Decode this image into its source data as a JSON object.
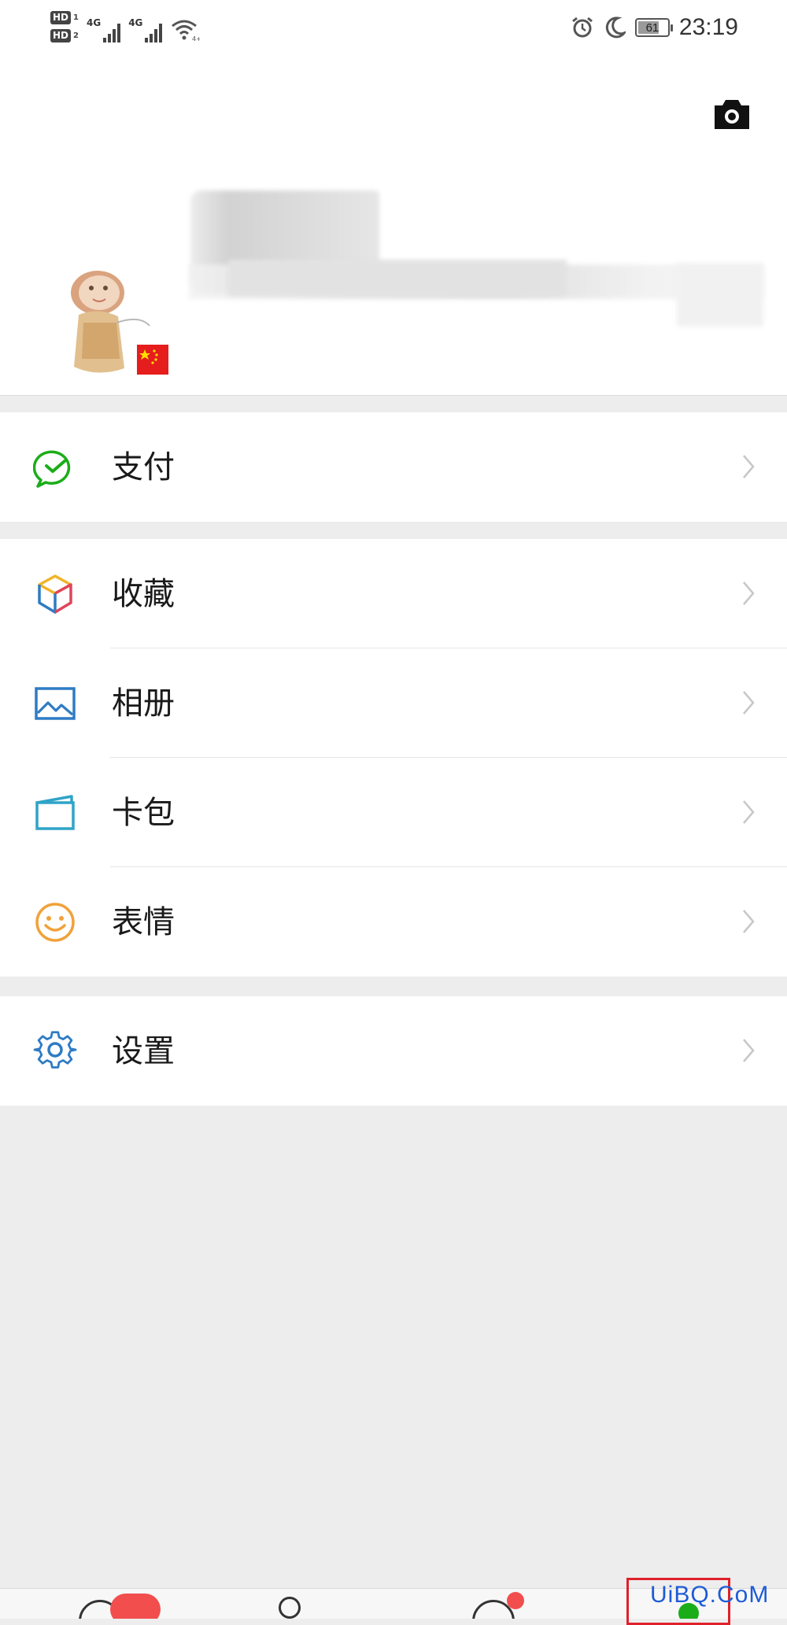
{
  "status_bar": {
    "sim1": "HD",
    "sim1_num": "1",
    "sim2": "HD",
    "sim2_num": "2",
    "net1": "4G",
    "net2": "4G",
    "battery": "61",
    "time": "23:19"
  },
  "profile": {
    "camera_icon": "camera-icon",
    "avatar_icon": "avatar-with-china-flag"
  },
  "menu": {
    "pay": {
      "label": "支付",
      "icon": "pay-check-icon",
      "color": "#1aad19"
    },
    "favorites": {
      "label": "收藏",
      "icon": "cube-icon"
    },
    "album": {
      "label": "相册",
      "icon": "picture-icon",
      "color": "#2e7bc4"
    },
    "cards": {
      "label": "卡包",
      "icon": "card-icon",
      "color": "#2fa3c7"
    },
    "stickers": {
      "label": "表情",
      "icon": "smiley-icon",
      "color": "#f0a23a"
    },
    "settings": {
      "label": "设置",
      "icon": "gear-icon",
      "color": "#2e7bc4"
    }
  },
  "watermark": "UiBQ.CoM"
}
